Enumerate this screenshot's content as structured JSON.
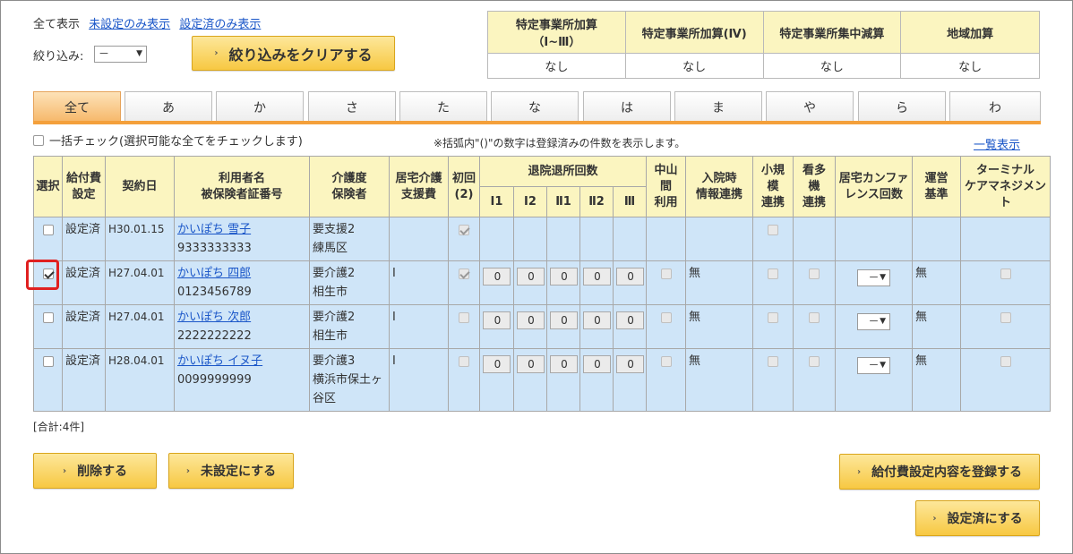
{
  "filters": {
    "show_all": "全て表示",
    "show_unset": "未設定のみ表示",
    "show_set": "設定済のみ表示",
    "narrow_label": "絞り込み:",
    "narrow_value": "－",
    "clear_button": "絞り込みをクリアする"
  },
  "addons": {
    "headers": [
      "特定事業所加算\n（Ⅰ~Ⅲ）",
      "特定事業所加算(Ⅳ)",
      "特定事業所集中減算",
      "地域加算"
    ],
    "values": [
      "なし",
      "なし",
      "なし",
      "なし"
    ]
  },
  "tabs": [
    "全て",
    "あ",
    "か",
    "さ",
    "た",
    "な",
    "は",
    "ま",
    "や",
    "ら",
    "わ"
  ],
  "bulk_check_label": "一括チェック(選択可能な全てをチェックします)",
  "note": "※括弧内\"()\"の数字は登録済みの件数を表示します。",
  "list_link": "一覧表示",
  "table": {
    "headers": {
      "select": "選択",
      "fee_setting": "給付費\n設定",
      "contract_date": "契約日",
      "user": "利用者名\n被保険者証番号",
      "care_level": "介護度\n保険者",
      "support_fee": "居宅介護\n支援費",
      "initial": "初回\n(2)",
      "discharge": "退院退所回数",
      "discharge_cols": [
        "Ⅰ1",
        "Ⅰ2",
        "Ⅱ1",
        "Ⅱ2",
        "Ⅲ"
      ],
      "nakayama": "中山\n間\n利用",
      "hospital_link": "入院時\n情報連携",
      "small_scale": "小規\n模\n連携",
      "nursing_multi": "看多\n機\n連携",
      "conference": "居宅カンファ\nレンス回数",
      "operation": "運営\n基準",
      "terminal": "ターミナル\nケアマネジメン\nト"
    },
    "rows": [
      {
        "selected": false,
        "status": "設定済",
        "date": "H30.01.15",
        "name": "かいぽち 雪子",
        "insured_no": "9333333333",
        "care": "要支援2",
        "insurer": "練馬区",
        "support": "",
        "initial": true,
        "has_counts": false,
        "counts": [],
        "hospital": "",
        "conference": "",
        "operation": ""
      },
      {
        "selected": true,
        "status": "設定済",
        "date": "H27.04.01",
        "name": "かいぽち 四郎",
        "insured_no": "0123456789",
        "care": "要介護2",
        "insurer": "相生市",
        "support": "Ⅰ",
        "initial": true,
        "has_counts": true,
        "counts": [
          "0",
          "0",
          "0",
          "0",
          "0"
        ],
        "hospital": "無",
        "conference": "－",
        "operation": "無"
      },
      {
        "selected": false,
        "status": "設定済",
        "date": "H27.04.01",
        "name": "かいぽち 次郎",
        "insured_no": "2222222222",
        "care": "要介護2",
        "insurer": "相生市",
        "support": "Ⅰ",
        "initial": false,
        "has_counts": true,
        "counts": [
          "0",
          "0",
          "0",
          "0",
          "0"
        ],
        "hospital": "無",
        "conference": "－",
        "operation": "無"
      },
      {
        "selected": false,
        "status": "設定済",
        "date": "H28.04.01",
        "name": "かいぽち イヌ子",
        "insured_no": "0099999999",
        "care": "要介護3",
        "insurer": "横浜市保土ヶ谷区",
        "support": "Ⅰ",
        "initial": false,
        "has_counts": true,
        "counts": [
          "0",
          "0",
          "0",
          "0",
          "0"
        ],
        "hospital": "無",
        "conference": "－",
        "operation": "無"
      }
    ]
  },
  "total": "[合計:4件]",
  "buttons": {
    "delete": "削除する",
    "unset": "未設定にする",
    "register": "給付費設定内容を登録する",
    "set_done": "設定済にする"
  },
  "colors": {
    "accent": "#f7c842",
    "header_bg": "#fbf5c0",
    "row_bg": "#cfe5f8",
    "tab_active": "#f6b86a",
    "link": "#1a56c8",
    "highlight": "#e02020"
  }
}
